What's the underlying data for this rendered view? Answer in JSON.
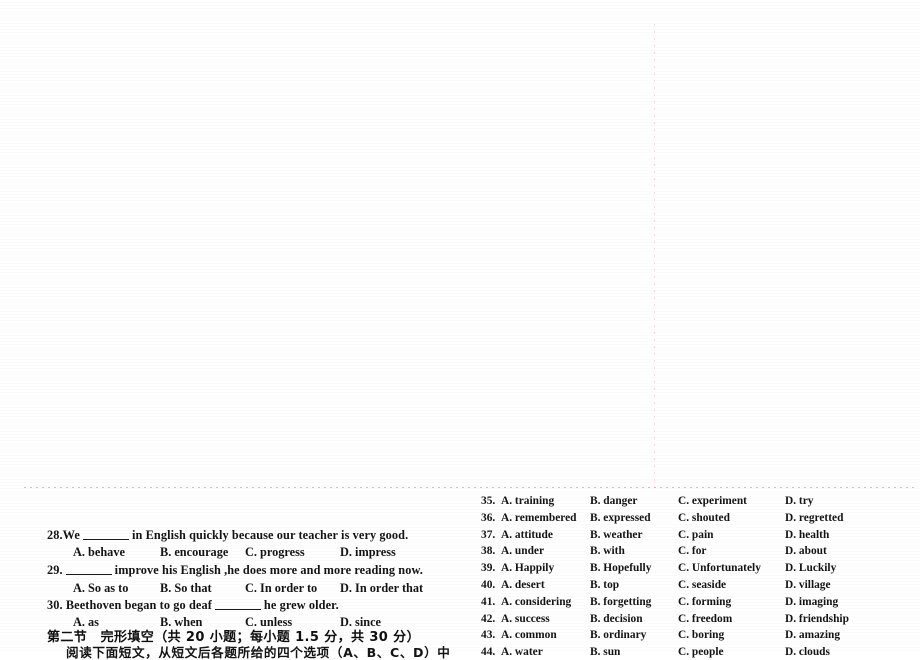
{
  "document": {
    "type": "scanned-exam-paper",
    "background_color": "#ffffff",
    "ink_color": "#141414"
  },
  "rules": {
    "vertical_guide_color": "#e9aac3",
    "horizontal_left_color": "#b0b0b0",
    "horizontal_right_color": "#f096b9"
  },
  "left_column": {
    "questions": [
      {
        "number": "28.",
        "stem_before": "28.We",
        "stem_after": "in English quickly because our teacher is very good.",
        "options": {
          "a": "A. behave",
          "b": "B. encourage",
          "c": "C. progress",
          "d": "D. impress"
        }
      },
      {
        "number": "29.",
        "stem_before": "29.",
        "stem_after": "improve his English ,he does more and more reading now.",
        "options": {
          "a": "A. So as to",
          "b": "B. So that",
          "c": "C. In order to",
          "d": "D. In order that"
        }
      },
      {
        "number": "30.",
        "stem_before": "30. Beethoven began to go deaf",
        "stem_after": "he grew older.",
        "options": {
          "a": "A. as",
          "b": "B. when",
          "c": "C. unless",
          "d": "D. since"
        }
      }
    ],
    "section_heading": "第二节　完形填空（共 20 小题；每小题 1.5 分，共 30 分）",
    "section_instruction": "阅读下面短文，从短文后各题所给的四个选项（A、B、C、D）中"
  },
  "right_column": {
    "rows": [
      {
        "num": "35.",
        "a": "A. training",
        "b": "B. danger",
        "c": "C. experiment",
        "d": "D. try"
      },
      {
        "num": "36.",
        "a": "A. remembered",
        "b": "B. expressed",
        "c": "C. shouted",
        "d": "D. regretted"
      },
      {
        "num": "37.",
        "a": "A. attitude",
        "b": "B. weather",
        "c": "C. pain",
        "d": "D. health"
      },
      {
        "num": "38.",
        "a": "A. under",
        "b": "B. with",
        "c": "C. for",
        "d": "D. about"
      },
      {
        "num": "39.",
        "a": "A. Happily",
        "b": "B. Hopefully",
        "c": "C. Unfortunately",
        "d": "D. Luckily"
      },
      {
        "num": "40.",
        "a": "A. desert",
        "b": "B. top",
        "c": "C. seaside",
        "d": "D. village"
      },
      {
        "num": "41.",
        "a": "A. considering",
        "b": "B. forgetting",
        "c": "C. forming",
        "d": "D. imaging"
      },
      {
        "num": "42.",
        "a": "A. success",
        "b": "B. decision",
        "c": "C. freedom",
        "d": "D. friendship"
      },
      {
        "num": "43.",
        "a": "A. common",
        "b": "B. ordinary",
        "c": "C. boring",
        "d": "D. amazing"
      },
      {
        "num": "44.",
        "a": "A. water",
        "b": "B. sun",
        "c": "C. people",
        "d": "D. clouds"
      }
    ]
  }
}
